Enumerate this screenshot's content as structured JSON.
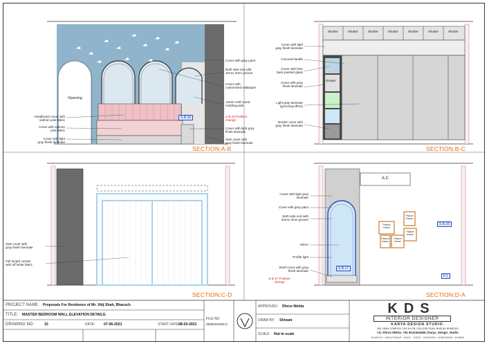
{
  "sections": {
    "ab": {
      "title": "SECTION:A-B",
      "opening": "Opening",
      "sb_tag": "S.B.18",
      "notes_left": [
        "Headboard cover with\nsalmon pink fabric",
        "Cover with salmon\npink fabric",
        "Cover with light\ngray finish laminate"
      ],
      "notes_right": [
        "Cover with gray paint",
        "Both side end with\n3mmx 3mm groove",
        "Cover with\ncustomized wallpaper",
        "12mm Half round\nmolding patti",
        "Cover with light gray\nfinish laminate",
        "Side cover with\ngray finish laminate"
      ],
      "note_red": "S.B.18 Position\nchange"
    },
    "bc": {
      "title": "SECTION:B-C",
      "shutter_labels": [
        "shutter",
        "shutter",
        "shutter",
        "shutter",
        "shutter",
        "shutter",
        "shutter"
      ],
      "shutter_side": "shutter",
      "notes_left": [
        "Cover with light\ngray finish laminate",
        "Conceal handle",
        "Cover with blue\nback painted glass",
        "Cover with gray\nfinish laminate",
        "Light gray laminate\n(grooving effect)",
        "Border cover with\ngray finish laminate"
      ]
    },
    "cd": {
      "title": "SECTION:C-D",
      "notes_left": [
        "Side cover with\ngray finish laminate",
        "Full length curtain\nwith off white fabric"
      ]
    },
    "da": {
      "title": "SECTION:D-A",
      "ac": "A.C",
      "frames": [
        "Picture\nframe",
        "Picture\nframe",
        "Picture\nframe",
        "Picture\nframe",
        "Picture\nframe"
      ],
      "sb_tag_16": "S.B.16",
      "sb_tag_17": "S.B.17",
      "tag_f1": "F.1",
      "notes_left": [
        "Cover with light gray\nlaminate",
        "Cover with gray paint",
        "Both side end with\n3mmx 3mm groove",
        "Mirror",
        "Profile light",
        "Shelf cover with gray\nfinish laminate"
      ],
      "note_red": "S.B.17 Position\nchange"
    }
  },
  "title_block": {
    "project_name_label": "PROJECT NAME:",
    "project_name": "Proposals For Residence of Mr. Xitij Shah, Bharuch.",
    "title_label": "TITLE:",
    "title": "MASTER BEDROOM WALL ELEVATION DETAILS.",
    "drawing_no_label": "DRAWING NO:",
    "drawing_no": "15",
    "date_label": "DATE:",
    "date": "07-06-2021",
    "start_date_label": "START DATE:",
    "start_date": "08-03-2021",
    "file_no_label": "FILE NO",
    "file_no": "250/KS/2020-2",
    "approved_label": "APPROVED:",
    "approved": "Dhruv Mehta",
    "drawn_label": "DRAW BY:",
    "drawn": "Shivani",
    "scale_label": "SCALE:",
    "scale": "Not to scale",
    "firm_logo": "KDS",
    "firm_subtitle": "INTERIOR DESIGNER",
    "firm_name": "KARYA DESIGN STUDIO.",
    "firm_address": "508, VINAY COMPLEX, OLD N.H 08, COLLEGE ROAD, BHOLAV, BHARUCH",
    "firm_contact": "I.D. Dhruv Mehta. +91 8141644466 | karya_design_studio",
    "firm_cities": "BHARUCH · ANKLESHWAR · DAHEJ · SURAT · VADODARA · AHMEDABAD · MUMBAI"
  },
  "colors": {
    "section_title": "#e8650a",
    "wallpaper": "#8fb4cb",
    "salmon": "#efc1c5",
    "dark_gray": "#6b6b6b",
    "light_gray": "#d9d9d9",
    "red_note": "#d21c1c",
    "tag_blue": "#2a4fb0",
    "frame_brown": "#c87828",
    "mirror_blue": "#cfe6f7",
    "curtain_blue": "#a9d2ea"
  }
}
